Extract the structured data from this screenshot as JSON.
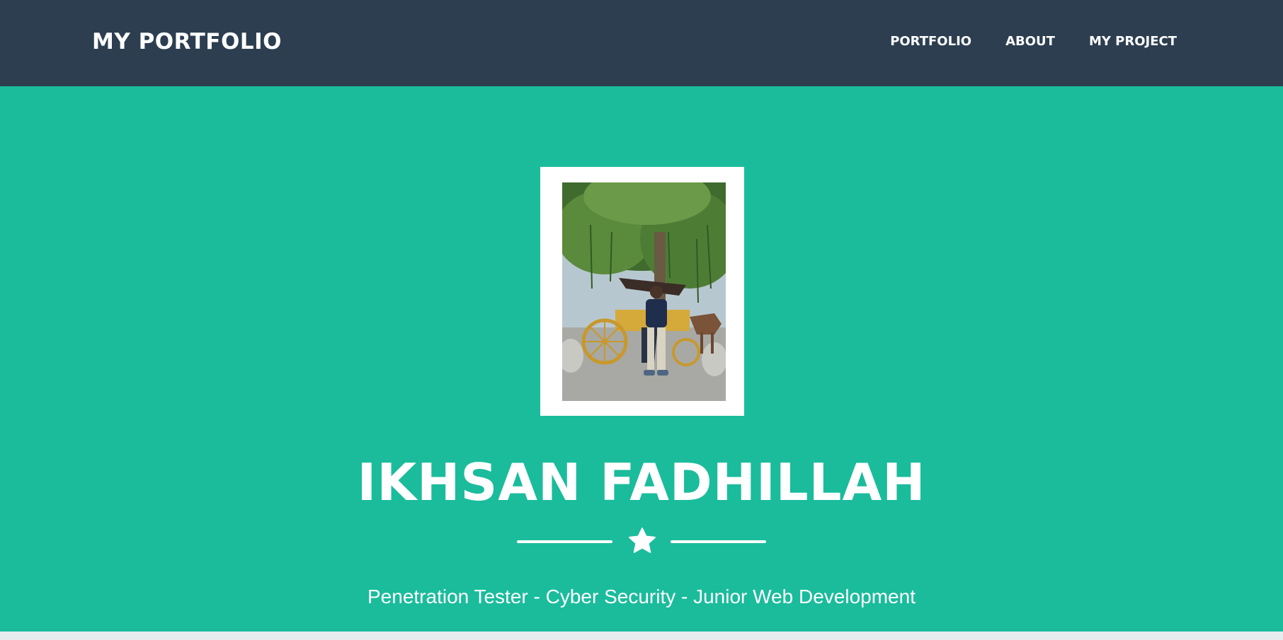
{
  "navbar": {
    "brand": "MY PORTFOLIO",
    "links": [
      {
        "label": "PORTFOLIO"
      },
      {
        "label": "ABOUT"
      },
      {
        "label": "MY PROJECT"
      }
    ]
  },
  "hero": {
    "name": "IKHSAN FADHILLAH",
    "subtitle": "Penetration Tester - Cyber Security - Junior Web Development",
    "divider_icon": "star-icon"
  },
  "colors": {
    "navbar_bg": "#2c3e50",
    "hero_bg": "#1abc9c",
    "text": "#ffffff"
  }
}
